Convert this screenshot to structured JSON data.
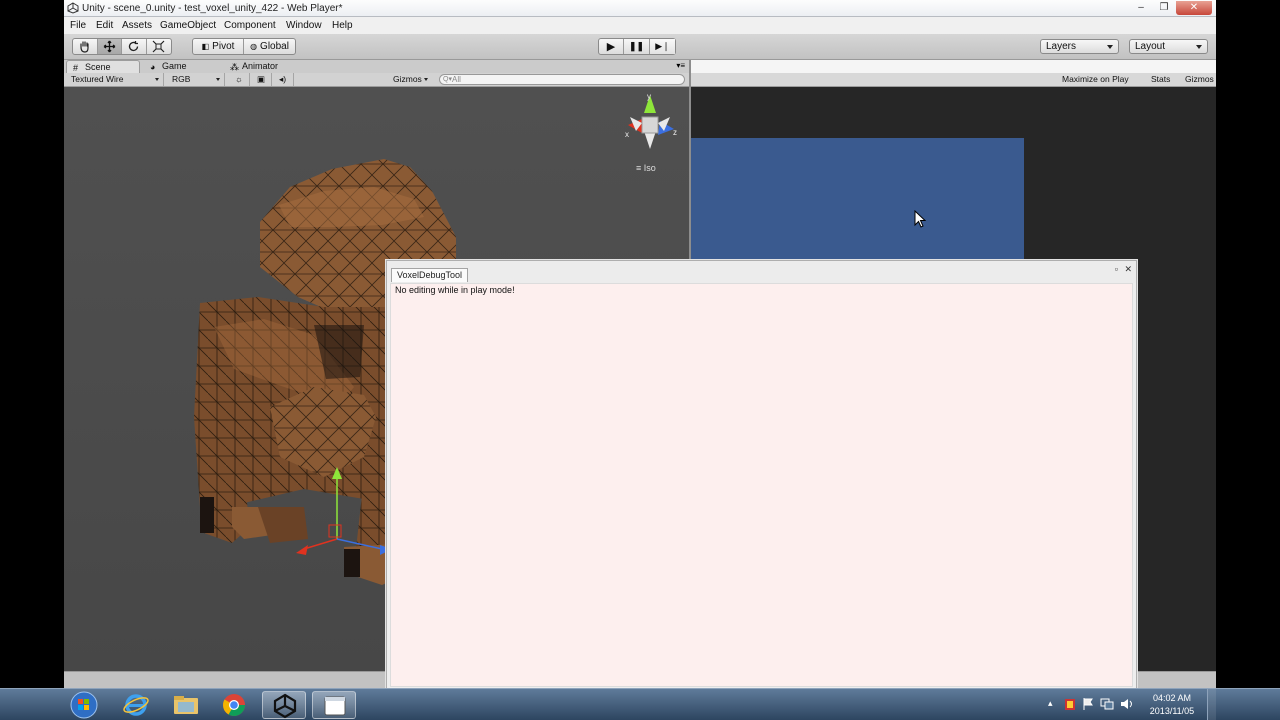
{
  "window": {
    "title": "Unity - scene_0.unity - test_voxel_unity_422 - Web Player*",
    "minimize_glyph": "–",
    "maximize_glyph": "❐",
    "close_glyph": "✕"
  },
  "menu": [
    "File",
    "Edit",
    "Assets",
    "GameObject",
    "Component",
    "Window",
    "Help"
  ],
  "toolbar": {
    "tools": [
      "hand-icon",
      "move-icon",
      "rotate-icon",
      "scale-icon"
    ],
    "pivot_label": "Pivot",
    "global_label": "Global",
    "play_glyph": "▶",
    "pause_glyph": "❚❚",
    "step_glyph": "▶❘",
    "layers_label": "Layers",
    "layout_label": "Layout"
  },
  "scene_panel": {
    "tabs": [
      {
        "label": "Scene",
        "icon": "#",
        "active": true
      },
      {
        "label": "Game",
        "icon": "◕",
        "active": false
      },
      {
        "label": "Animator",
        "icon": "⁂",
        "active": false
      }
    ],
    "render_mode": "Textured Wire",
    "color_mode": "RGB",
    "gizmos_label": "Gizmos",
    "search_placeholder": "All",
    "search_prefix": "Q▾",
    "iso_label": "≡ Iso",
    "axis_labels": {
      "y": "y",
      "x": "x",
      "z": "z"
    }
  },
  "game_panel": {
    "maximize_on_play": "Maximize on Play",
    "stats": "Stats",
    "gizmos": "Gizmos",
    "viewport_color": "#3a5a8f"
  },
  "voxel_window": {
    "tab_label": "VoxelDebugTool",
    "message": "No editing while in play mode!",
    "restore_glyph": "▫",
    "close_glyph": "✕"
  },
  "taskbar": {
    "apps": [
      "windows-start-icon",
      "internet-explorer-icon",
      "file-explorer-icon",
      "chrome-icon",
      "unity-icon",
      "blank-window-icon"
    ],
    "clock_time": "04:02 AM",
    "clock_date": "2013/11/05"
  },
  "colors": {
    "voxel_brown": "#8a5a34",
    "voxel_dark": "#1c1410",
    "background_scene": "#4b4b4b",
    "game_background": "#262626",
    "gizmo_x": "#e0321f",
    "gizmo_y": "#8ee63a",
    "gizmo_z": "#3b6fe0"
  }
}
